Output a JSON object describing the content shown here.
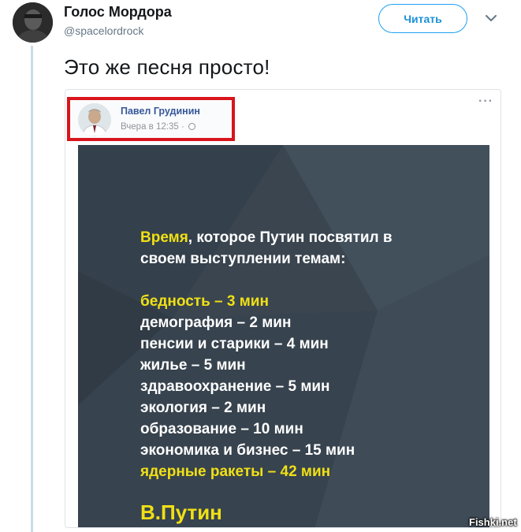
{
  "tweet": {
    "author_name": "Голос Мордора",
    "author_handle": "@spacelordrock",
    "follow_label": "Читать",
    "text": "Это же песня просто!"
  },
  "facebook_post": {
    "author_name": "Павел Грудинин",
    "timestamp": "Вчера в 12:35 ·",
    "more_label": "···"
  },
  "card": {
    "heading_highlight": "Время",
    "heading_rest_1": ", которое Путин посвятил в",
    "heading_rest_2": "своем выступлении темам:",
    "topics": [
      {
        "text": "бедность – 3 мин",
        "color": "#f0e015"
      },
      {
        "text": "демография – 2 мин",
        "color": "#ffffff"
      },
      {
        "text": "пенсии и старики – 4 мин",
        "color": "#ffffff"
      },
      {
        "text": "жилье – 5 мин",
        "color": "#ffffff"
      },
      {
        "text": "здравоохранение – 5 мин",
        "color": "#ffffff"
      },
      {
        "text": "экология – 2 мин",
        "color": "#ffffff"
      },
      {
        "text": "образование – 10 мин",
        "color": "#ffffff"
      },
      {
        "text": "экономика и бизнес – 15 мин",
        "color": "#ffffff"
      },
      {
        "text": "ядерные ракеты – 42 мин",
        "color": "#f0e015"
      }
    ],
    "signature": "В.Путин"
  },
  "watermark": "Fishki.net",
  "colors": {
    "accent": "#1da1f2",
    "highlight_box": "#d9141c",
    "card_background": "#3a4550",
    "card_highlight_text": "#f0e015"
  },
  "icons": {
    "caret": "chevron-down-icon",
    "globe": "globe-icon"
  }
}
